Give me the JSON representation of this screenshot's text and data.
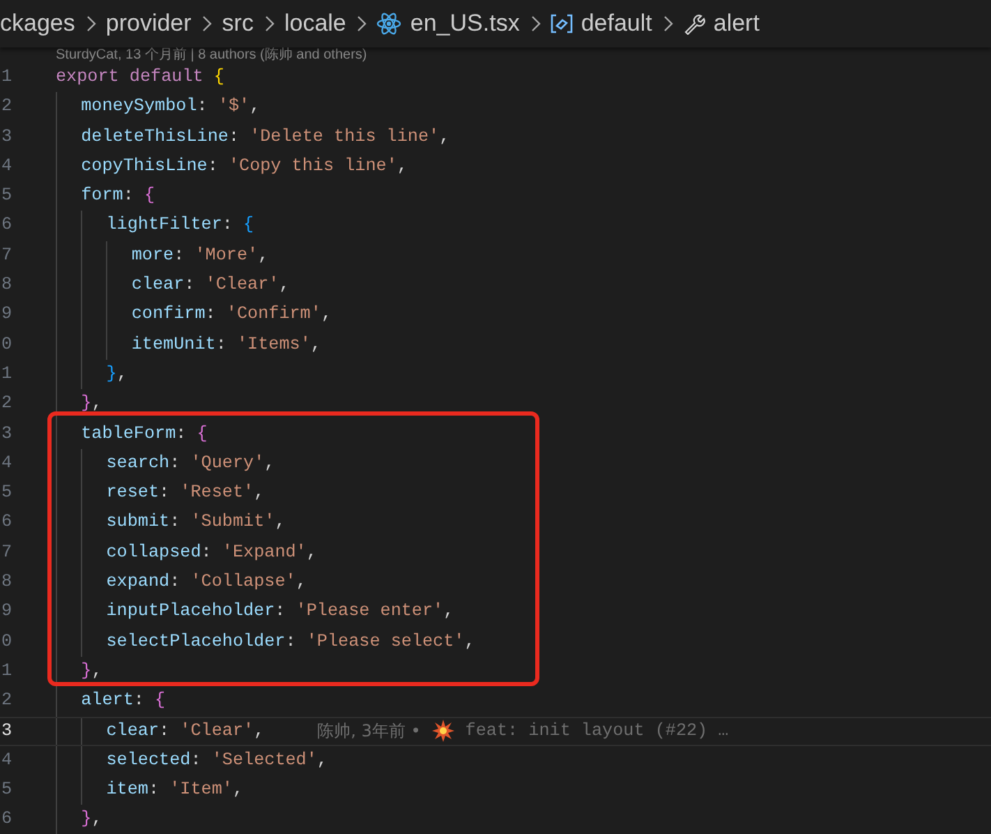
{
  "breadcrumb": [
    {
      "kind": "folder",
      "label": "ckages"
    },
    {
      "kind": "folder",
      "label": "provider"
    },
    {
      "kind": "folder",
      "label": "src"
    },
    {
      "kind": "folder",
      "label": "locale"
    },
    {
      "kind": "react-file",
      "label": "en_US.tsx"
    },
    {
      "kind": "module",
      "label": "default"
    },
    {
      "kind": "property",
      "label": "alert"
    }
  ],
  "codelens": "SturdyCat, 13 个月前 | 8 authors (陈帅 and others)",
  "lines": [
    {
      "kind": "line",
      "number": "1",
      "tokens": [
        {
          "kind": "keyword",
          "text": "export default "
        },
        {
          "kind": "brace",
          "text": "{",
          "color": "#ffd700"
        }
      ],
      "children": [
        {
          "kind": "line",
          "number": "2",
          "tokens": [
            {
              "kind": "key",
              "text": "moneySymbol"
            },
            {
              "kind": "punct",
              "text": ": "
            },
            {
              "kind": "string",
              "text": "'$'"
            },
            {
              "kind": "punct",
              "text": ","
            }
          ]
        },
        {
          "kind": "line",
          "number": "3",
          "tokens": [
            {
              "kind": "key",
              "text": "deleteThisLine"
            },
            {
              "kind": "punct",
              "text": ": "
            },
            {
              "kind": "string",
              "text": "'Delete this line'"
            },
            {
              "kind": "punct",
              "text": ","
            }
          ]
        },
        {
          "kind": "line",
          "number": "4",
          "tokens": [
            {
              "kind": "key",
              "text": "copyThisLine"
            },
            {
              "kind": "punct",
              "text": ": "
            },
            {
              "kind": "string",
              "text": "'Copy this line'"
            },
            {
              "kind": "punct",
              "text": ","
            }
          ]
        },
        {
          "kind": "line",
          "number": "5",
          "tokens": [
            {
              "kind": "key",
              "text": "form"
            },
            {
              "kind": "punct",
              "text": ": "
            },
            {
              "kind": "brace",
              "text": "{",
              "color": "#da70d6"
            }
          ],
          "children": [
            {
              "kind": "line",
              "number": "6",
              "tokens": [
                {
                  "kind": "key",
                  "text": "lightFilter"
                },
                {
                  "kind": "punct",
                  "text": ": "
                },
                {
                  "kind": "brace",
                  "text": "{",
                  "color": "#179fff"
                }
              ],
              "children": [
                {
                  "kind": "line",
                  "number": "7",
                  "tokens": [
                    {
                      "kind": "key",
                      "text": "more"
                    },
                    {
                      "kind": "punct",
                      "text": ": "
                    },
                    {
                      "kind": "string",
                      "text": "'More'"
                    },
                    {
                      "kind": "punct",
                      "text": ","
                    }
                  ]
                },
                {
                  "kind": "line",
                  "number": "8",
                  "tokens": [
                    {
                      "kind": "key",
                      "text": "clear"
                    },
                    {
                      "kind": "punct",
                      "text": ": "
                    },
                    {
                      "kind": "string",
                      "text": "'Clear'"
                    },
                    {
                      "kind": "punct",
                      "text": ","
                    }
                  ]
                },
                {
                  "kind": "line",
                  "number": "9",
                  "tokens": [
                    {
                      "kind": "key",
                      "text": "confirm"
                    },
                    {
                      "kind": "punct",
                      "text": ": "
                    },
                    {
                      "kind": "string",
                      "text": "'Confirm'"
                    },
                    {
                      "kind": "punct",
                      "text": ","
                    }
                  ]
                },
                {
                  "kind": "line",
                  "number": "0",
                  "tokens": [
                    {
                      "kind": "key",
                      "text": "itemUnit"
                    },
                    {
                      "kind": "punct",
                      "text": ": "
                    },
                    {
                      "kind": "string",
                      "text": "'Items'"
                    },
                    {
                      "kind": "punct",
                      "text": ","
                    }
                  ]
                }
              ]
            },
            {
              "kind": "line",
              "number": "1",
              "tokens": [
                {
                  "kind": "brace",
                  "text": "}",
                  "color": "#179fff"
                },
                {
                  "kind": "punct",
                  "text": ","
                }
              ]
            }
          ]
        },
        {
          "kind": "line",
          "number": "2",
          "tokens": [
            {
              "kind": "brace",
              "text": "}",
              "color": "#da70d6"
            },
            {
              "kind": "punct",
              "text": ","
            }
          ]
        },
        {
          "kind": "highlight-box",
          "children": [
            {
              "kind": "line",
              "number": "3",
              "tokens": [
                {
                  "kind": "key",
                  "text": "tableForm"
                },
                {
                  "kind": "punct",
                  "text": ": "
                },
                {
                  "kind": "brace",
                  "text": "{",
                  "color": "#da70d6"
                }
              ],
              "children": [
                {
                  "kind": "line",
                  "number": "4",
                  "tokens": [
                    {
                      "kind": "key",
                      "text": "search"
                    },
                    {
                      "kind": "punct",
                      "text": ": "
                    },
                    {
                      "kind": "string",
                      "text": "'Query'"
                    },
                    {
                      "kind": "punct",
                      "text": ","
                    }
                  ]
                },
                {
                  "kind": "line",
                  "number": "5",
                  "tokens": [
                    {
                      "kind": "key",
                      "text": "reset"
                    },
                    {
                      "kind": "punct",
                      "text": ": "
                    },
                    {
                      "kind": "string",
                      "text": "'Reset'"
                    },
                    {
                      "kind": "punct",
                      "text": ","
                    }
                  ]
                },
                {
                  "kind": "line",
                  "number": "6",
                  "tokens": [
                    {
                      "kind": "key",
                      "text": "submit"
                    },
                    {
                      "kind": "punct",
                      "text": ": "
                    },
                    {
                      "kind": "string",
                      "text": "'Submit'"
                    },
                    {
                      "kind": "punct",
                      "text": ","
                    }
                  ]
                },
                {
                  "kind": "line",
                  "number": "7",
                  "tokens": [
                    {
                      "kind": "key",
                      "text": "collapsed"
                    },
                    {
                      "kind": "punct",
                      "text": ": "
                    },
                    {
                      "kind": "string",
                      "text": "'Expand'"
                    },
                    {
                      "kind": "punct",
                      "text": ","
                    }
                  ]
                },
                {
                  "kind": "line",
                  "number": "8",
                  "tokens": [
                    {
                      "kind": "key",
                      "text": "expand"
                    },
                    {
                      "kind": "punct",
                      "text": ": "
                    },
                    {
                      "kind": "string",
                      "text": "'Collapse'"
                    },
                    {
                      "kind": "punct",
                      "text": ","
                    }
                  ]
                },
                {
                  "kind": "line",
                  "number": "9",
                  "tokens": [
                    {
                      "kind": "key",
                      "text": "inputPlaceholder"
                    },
                    {
                      "kind": "punct",
                      "text": ": "
                    },
                    {
                      "kind": "string",
                      "text": "'Please enter'"
                    },
                    {
                      "kind": "punct",
                      "text": ","
                    }
                  ]
                },
                {
                  "kind": "line",
                  "number": "0",
                  "tokens": [
                    {
                      "kind": "key",
                      "text": "selectPlaceholder"
                    },
                    {
                      "kind": "punct",
                      "text": ": "
                    },
                    {
                      "kind": "string",
                      "text": "'Please select'"
                    },
                    {
                      "kind": "punct",
                      "text": ","
                    }
                  ]
                }
              ]
            },
            {
              "kind": "line",
              "number": "1",
              "tokens": [
                {
                  "kind": "brace",
                  "text": "}",
                  "color": "#da70d6"
                },
                {
                  "kind": "punct",
                  "text": ","
                }
              ]
            }
          ]
        },
        {
          "kind": "line",
          "number": "2",
          "tokens": [
            {
              "kind": "key",
              "text": "alert"
            },
            {
              "kind": "punct",
              "text": ": "
            },
            {
              "kind": "brace",
              "text": "{",
              "color": "#da70d6"
            }
          ],
          "children": [
            {
              "kind": "line",
              "number": "3",
              "current": true,
              "tokens": [
                {
                  "kind": "key",
                  "text": "clear"
                },
                {
                  "kind": "punct",
                  "text": ": "
                },
                {
                  "kind": "string",
                  "text": "'Clear'"
                },
                {
                  "kind": "punct",
                  "text": ","
                }
              ],
              "blame": {
                "author": "陈帅, 3年前 •",
                "message": "feat: init layout (#22) …"
              }
            },
            {
              "kind": "line",
              "number": "4",
              "tokens": [
                {
                  "kind": "key",
                  "text": "selected"
                },
                {
                  "kind": "punct",
                  "text": ": "
                },
                {
                  "kind": "string",
                  "text": "'Selected'"
                },
                {
                  "kind": "punct",
                  "text": ","
                }
              ]
            },
            {
              "kind": "line",
              "number": "5",
              "tokens": [
                {
                  "kind": "key",
                  "text": "item"
                },
                {
                  "kind": "punct",
                  "text": ": "
                },
                {
                  "kind": "string",
                  "text": "'Item'"
                },
                {
                  "kind": "punct",
                  "text": ","
                }
              ]
            }
          ]
        },
        {
          "kind": "line",
          "number": "6",
          "tokens": [
            {
              "kind": "brace",
              "text": "}",
              "color": "#da70d6"
            },
            {
              "kind": "punct",
              "text": ","
            }
          ]
        }
      ]
    }
  ]
}
